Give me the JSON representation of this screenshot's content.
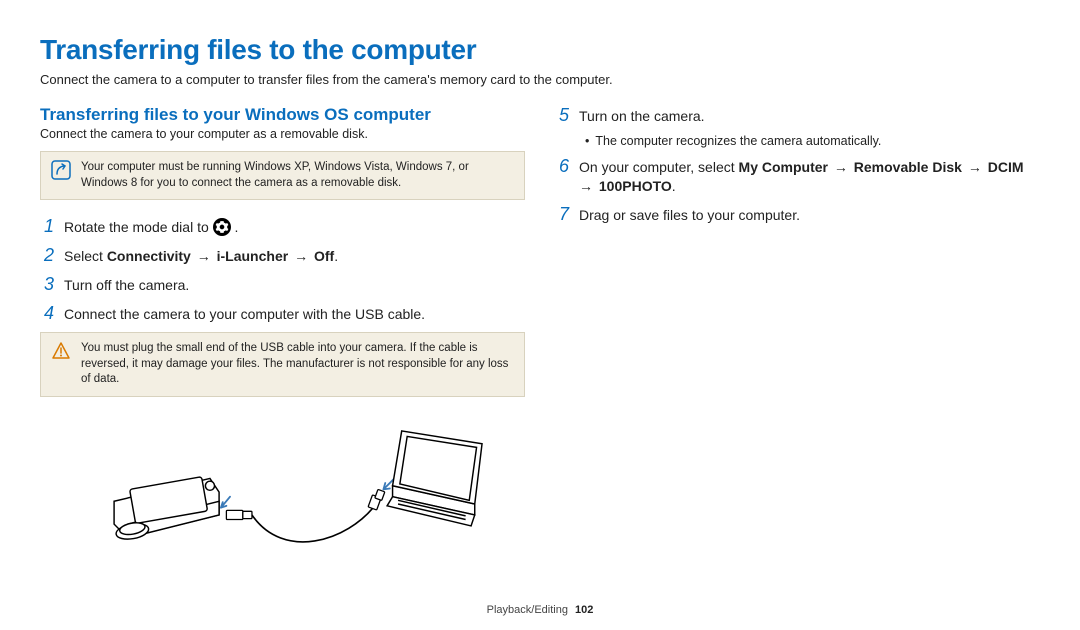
{
  "title": "Transferring files to the computer",
  "intro": "Connect the camera to a computer to transfer files from the camera's memory card to the computer.",
  "section": {
    "title": "Transferring files to your Windows OS computer",
    "intro": "Connect the camera to your computer as a removable disk."
  },
  "note1": "Your computer must be running Windows XP, Windows Vista, Windows 7, or Windows 8 for you to connect the camera as a removable disk.",
  "steps_left": {
    "s1_pre": "Rotate the mode dial to ",
    "s1_post": " .",
    "s2_a": "Select ",
    "s2_b1": "Connectivity",
    "s2_arrow": " → ",
    "s2_b2": "i-Launcher",
    "s2_b3": "Off",
    "s2_c": ".",
    "s3": "Turn off the camera.",
    "s4": "Connect the camera to your computer with the USB cable."
  },
  "warn": "You must plug the small end of the USB cable into your camera. If the cable is reversed, it may damage your files. The manufacturer is not responsible for any loss of data.",
  "steps_right": {
    "s5": "Turn on the camera.",
    "s5_sub": "The computer recognizes the camera automatically.",
    "s6_a": "On your computer, select ",
    "s6_b1": "My Computer",
    "s6_arrow": " → ",
    "s6_b2": "Removable Disk",
    "s6_b3": "DCIM",
    "s6_b4": "100PHOTO",
    "s6_c": ".",
    "s7": "Drag or save files to your computer."
  },
  "footer": {
    "section": "Playback/Editing",
    "page": "102"
  },
  "nums": {
    "n1": "1",
    "n2": "2",
    "n3": "3",
    "n4": "4",
    "n5": "5",
    "n6": "6",
    "n7": "7"
  }
}
